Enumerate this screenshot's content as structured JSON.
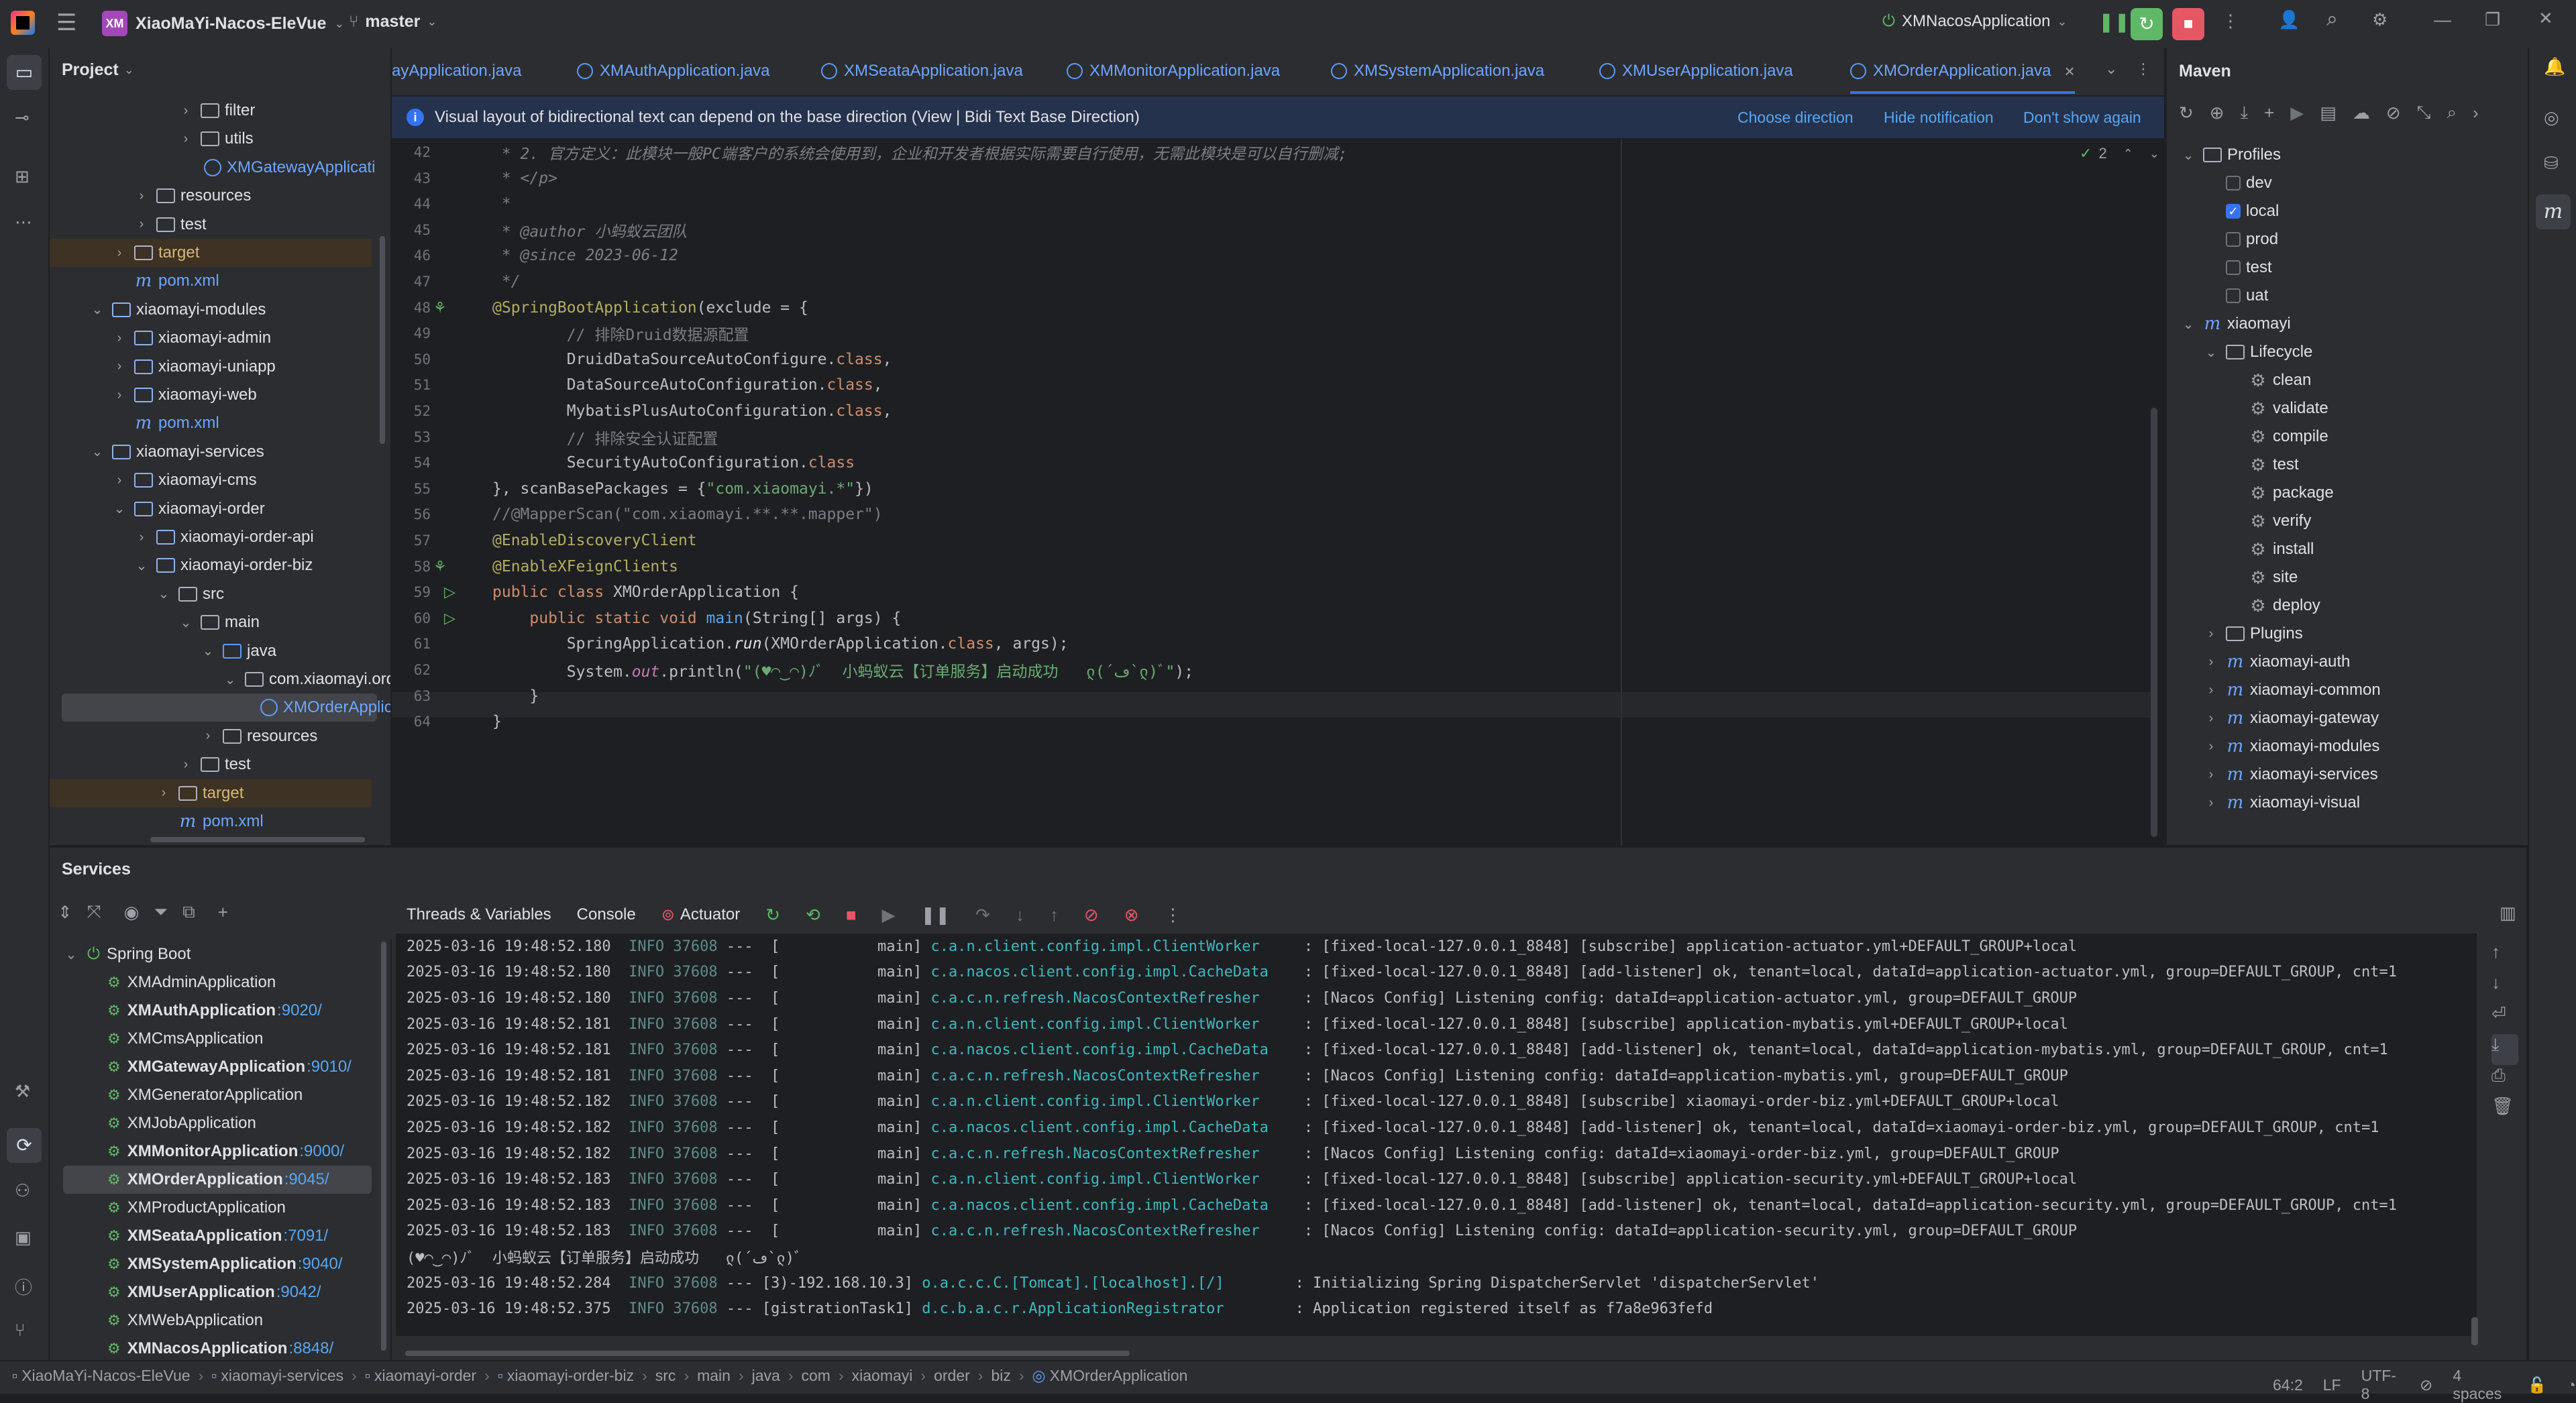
{
  "app": {
    "project_name": "XiaoMaYi-Nacos-EleVue",
    "project_badge": "XM",
    "branch": "master",
    "run_config": "XMNacosApplication"
  },
  "colors": {
    "accent": "#3574f0",
    "run_green": "#5fb865",
    "stop_red": "#e55765",
    "tab_blue": "#6ea6ff"
  },
  "project_panel": {
    "title": "Project",
    "tree": [
      {
        "label": "filter",
        "indent": 5,
        "icon": "folder",
        "arrow": "right"
      },
      {
        "label": "utils",
        "indent": 5,
        "icon": "folder",
        "arrow": "right"
      },
      {
        "label": "XMGatewayApplicati",
        "indent": 6,
        "icon": "class",
        "color": "blue"
      },
      {
        "label": "resources",
        "indent": 3,
        "icon": "folder-res",
        "arrow": "right"
      },
      {
        "label": "test",
        "indent": 3,
        "icon": "folder",
        "arrow": "right"
      },
      {
        "label": "target",
        "indent": 2,
        "icon": "folder",
        "arrow": "right",
        "color": "yellow",
        "hl": "orange"
      },
      {
        "label": "pom.xml",
        "indent": 2,
        "icon": "maven",
        "color": "blue"
      },
      {
        "label": "xiaomayi-modules",
        "indent": 1,
        "icon": "folder-mod",
        "arrow": "down"
      },
      {
        "label": "xiaomayi-admin",
        "indent": 2,
        "icon": "folder-mod",
        "arrow": "right"
      },
      {
        "label": "xiaomayi-uniapp",
        "indent": 2,
        "icon": "folder-mod",
        "arrow": "right"
      },
      {
        "label": "xiaomayi-web",
        "indent": 2,
        "icon": "folder-mod",
        "arrow": "right"
      },
      {
        "label": "pom.xml",
        "indent": 2,
        "icon": "maven",
        "color": "blue"
      },
      {
        "label": "xiaomayi-services",
        "indent": 1,
        "icon": "folder-mod",
        "arrow": "down"
      },
      {
        "label": "xiaomayi-cms",
        "indent": 2,
        "icon": "folder-mod",
        "arrow": "right"
      },
      {
        "label": "xiaomayi-order",
        "indent": 2,
        "icon": "folder-mod",
        "arrow": "down"
      },
      {
        "label": "xiaomayi-order-api",
        "indent": 3,
        "icon": "folder-mod",
        "arrow": "right"
      },
      {
        "label": "xiaomayi-order-biz",
        "indent": 3,
        "icon": "folder-mod",
        "arrow": "down"
      },
      {
        "label": "src",
        "indent": 4,
        "icon": "folder",
        "arrow": "down"
      },
      {
        "label": "main",
        "indent": 5,
        "icon": "folder",
        "arrow": "down"
      },
      {
        "label": "java",
        "indent": 6,
        "icon": "folder-src",
        "arrow": "down"
      },
      {
        "label": "com.xiaomayi.ord",
        "indent": 7,
        "icon": "folder",
        "arrow": "down"
      },
      {
        "label": "XMOrderApplic",
        "indent": 8,
        "icon": "class",
        "color": "blue",
        "hl": "sel"
      },
      {
        "label": "resources",
        "indent": 6,
        "icon": "folder-res",
        "arrow": "right"
      },
      {
        "label": "test",
        "indent": 5,
        "icon": "folder",
        "arrow": "right"
      },
      {
        "label": "target",
        "indent": 4,
        "icon": "folder",
        "arrow": "right",
        "color": "yellow",
        "hl": "orange"
      },
      {
        "label": "pom.xml",
        "indent": 4,
        "icon": "maven",
        "color": "blue"
      },
      {
        "label": "pom.xml",
        "indent": 3,
        "icon": "maven",
        "color": "blue"
      }
    ]
  },
  "editor": {
    "tabs": [
      {
        "label": "ayApplication.java"
      },
      {
        "label": "XMAuthApplication.java"
      },
      {
        "label": "XMSeataApplication.java"
      },
      {
        "label": "XMMonitorApplication.java"
      },
      {
        "label": "XMSystemApplication.java"
      },
      {
        "label": "XMUserApplication.java"
      },
      {
        "label": "XMOrderApplication.java",
        "active": true
      }
    ],
    "notification": {
      "text": "Visual layout of bidirectional text can depend on the base direction (View | Bidi Text Base Direction)",
      "choose": "Choose direction",
      "hide": "Hide notification",
      "dont_show": "Don't show again"
    },
    "inspection_count": "2",
    "lines": [
      {
        "n": "42",
        "code": [
          [
            " * 2. 官方定义：此模块一般PC端客户的系统会使用到，企业和开发者根据实际需要自行使用，无需此模块是可以自行删减;",
            "cm it"
          ]
        ]
      },
      {
        "n": "43",
        "code": [
          [
            " * </p>",
            "cm it"
          ]
        ]
      },
      {
        "n": "44",
        "code": [
          [
            " *",
            "cm it"
          ]
        ]
      },
      {
        "n": "45",
        "code": [
          [
            " * ",
            "cm it"
          ],
          [
            "@author",
            "cm it"
          ],
          [
            " 小蚂蚁云团队",
            "cm it"
          ]
        ]
      },
      {
        "n": "46",
        "code": [
          [
            " * ",
            "cm it"
          ],
          [
            "@since",
            "cm it"
          ],
          [
            " 2023-06-12",
            "cm it"
          ]
        ]
      },
      {
        "n": "47",
        "code": [
          [
            " */",
            "cm it"
          ]
        ]
      },
      {
        "n": "48",
        "code": [
          [
            "@SpringBootApplication",
            "an"
          ],
          [
            "(exclude = {",
            "pu"
          ]
        ]
      },
      {
        "n": "49",
        "code": [
          [
            "        // 排除Druid数据源配置",
            "cm"
          ]
        ]
      },
      {
        "n": "50",
        "code": [
          [
            "        DruidDataSourceAutoConfigure.",
            "pu"
          ],
          [
            "class",
            "k"
          ],
          [
            ",",
            "pu"
          ]
        ]
      },
      {
        "n": "51",
        "code": [
          [
            "        DataSourceAutoConfiguration.",
            "pu"
          ],
          [
            "class",
            "k"
          ],
          [
            ",",
            "pu"
          ]
        ]
      },
      {
        "n": "52",
        "code": [
          [
            "        MybatisPlusAutoConfiguration.",
            "pu"
          ],
          [
            "class",
            "k"
          ],
          [
            ",",
            "pu"
          ]
        ]
      },
      {
        "n": "53",
        "code": [
          [
            "        // 排除安全认证配置",
            "cm"
          ]
        ]
      },
      {
        "n": "54",
        "code": [
          [
            "        SecurityAutoConfiguration.",
            "pu"
          ],
          [
            "class",
            "k"
          ]
        ]
      },
      {
        "n": "55",
        "code": [
          [
            "}, scanBasePackages = {",
            "pu"
          ],
          [
            "\"com.xiaomayi.*\"",
            "st"
          ],
          [
            "})",
            "pu"
          ]
        ]
      },
      {
        "n": "56",
        "code": [
          [
            "//@MapperScan(\"com.xiaomayi.**.**.mapper\")",
            "cm"
          ]
        ]
      },
      {
        "n": "57",
        "code": [
          [
            "@EnableDiscoveryClient",
            "an"
          ]
        ]
      },
      {
        "n": "58",
        "code": [
          [
            "@EnableXFeignClients",
            "an"
          ]
        ]
      },
      {
        "n": "59",
        "code": [
          [
            "public class ",
            "k"
          ],
          [
            "XMOrderApplication ",
            "pu"
          ],
          [
            "{",
            "pu"
          ]
        ]
      },
      {
        "n": "60",
        "code": [
          [
            "    public static void ",
            "k"
          ],
          [
            "main",
            "fn"
          ],
          [
            "(String[] args) {",
            "pu"
          ]
        ]
      },
      {
        "n": "61",
        "code": [
          [
            "        SpringApplication.",
            "pu"
          ],
          [
            "run",
            "it"
          ],
          [
            "(XMOrderApplication.",
            "pu"
          ],
          [
            "class",
            "k"
          ],
          [
            ", args);",
            "pu"
          ]
        ]
      },
      {
        "n": "62",
        "code": [
          [
            "        System.",
            "pu"
          ],
          [
            "out",
            "sf"
          ],
          [
            ".println(",
            "pu"
          ],
          [
            "\"(♥◠‿◠)ﾉﾞ  小蚂蚁云【订单服务】启动成功   ლ(´ڡ`ლ)ﾞ\"",
            "st"
          ],
          [
            ");",
            "pu"
          ]
        ]
      },
      {
        "n": "63",
        "code": [
          [
            "    }",
            "pu"
          ]
        ]
      },
      {
        "n": "64",
        "code": [
          [
            "}",
            "pu"
          ]
        ]
      }
    ],
    "gutter_marks": {
      "48": "spring",
      "58": "spring",
      "59": "run",
      "60": "run"
    }
  },
  "maven": {
    "title": "Maven",
    "tree": [
      {
        "label": "Profiles",
        "indent": 0,
        "arrow": "down",
        "icon": "folder"
      },
      {
        "label": "dev",
        "indent": 1,
        "icon": "check",
        "checked": false
      },
      {
        "label": "local",
        "indent": 1,
        "icon": "check",
        "checked": true
      },
      {
        "label": "prod",
        "indent": 1,
        "icon": "check",
        "checked": false
      },
      {
        "label": "test",
        "indent": 1,
        "icon": "check",
        "checked": false
      },
      {
        "label": "uat",
        "indent": 1,
        "icon": "check",
        "checked": false
      },
      {
        "label": "xiaomayi",
        "indent": 0,
        "arrow": "down",
        "icon": "maven"
      },
      {
        "label": "Lifecycle",
        "indent": 1,
        "arrow": "down",
        "icon": "folder"
      },
      {
        "label": "clean",
        "indent": 2,
        "icon": "gear"
      },
      {
        "label": "validate",
        "indent": 2,
        "icon": "gear"
      },
      {
        "label": "compile",
        "indent": 2,
        "icon": "gear"
      },
      {
        "label": "test",
        "indent": 2,
        "icon": "gear"
      },
      {
        "label": "package",
        "indent": 2,
        "icon": "gear"
      },
      {
        "label": "verify",
        "indent": 2,
        "icon": "gear"
      },
      {
        "label": "install",
        "indent": 2,
        "icon": "gear"
      },
      {
        "label": "site",
        "indent": 2,
        "icon": "gear"
      },
      {
        "label": "deploy",
        "indent": 2,
        "icon": "gear"
      },
      {
        "label": "Plugins",
        "indent": 1,
        "arrow": "right",
        "icon": "folder"
      },
      {
        "label": "xiaomayi-auth",
        "indent": 1,
        "arrow": "right",
        "icon": "maven"
      },
      {
        "label": "xiaomayi-common",
        "indent": 1,
        "arrow": "right",
        "icon": "maven"
      },
      {
        "label": "xiaomayi-gateway",
        "indent": 1,
        "arrow": "right",
        "icon": "maven"
      },
      {
        "label": "xiaomayi-modules",
        "indent": 1,
        "arrow": "right",
        "icon": "maven"
      },
      {
        "label": "xiaomayi-services",
        "indent": 1,
        "arrow": "right",
        "icon": "maven"
      },
      {
        "label": "xiaomayi-visual",
        "indent": 1,
        "arrow": "right",
        "icon": "maven"
      }
    ]
  },
  "services": {
    "title": "Services",
    "root": "Spring Boot",
    "apps": [
      {
        "name": "XMAdminApplication",
        "port": "",
        "running": false
      },
      {
        "name": "XMAuthApplication",
        "port": ":9020/",
        "running": true
      },
      {
        "name": "XMCmsApplication",
        "port": "",
        "running": false
      },
      {
        "name": "XMGatewayApplication",
        "port": ":9010/",
        "running": true
      },
      {
        "name": "XMGeneratorApplication",
        "port": "",
        "running": false
      },
      {
        "name": "XMJobApplication",
        "port": "",
        "running": false
      },
      {
        "name": "XMMonitorApplication",
        "port": ":9000/",
        "running": true
      },
      {
        "name": "XMOrderApplication",
        "port": ":9045/",
        "running": true,
        "selected": true
      },
      {
        "name": "XMProductApplication",
        "port": "",
        "running": false
      },
      {
        "name": "XMSeataApplication",
        "port": ":7091/",
        "running": true
      },
      {
        "name": "XMSystemApplication",
        "port": ":9040/",
        "running": true
      },
      {
        "name": "XMUserApplication",
        "port": ":9042/",
        "running": true
      },
      {
        "name": "XMWebApplication",
        "port": "",
        "running": false
      },
      {
        "name": "XMNacosApplication",
        "port": ":8848/",
        "running": true
      }
    ],
    "console_tabs": [
      "Threads & Variables",
      "Console",
      "Actuator"
    ],
    "log": [
      {
        "ts": "2025-03-16 19:48:52.180",
        "lvl": "INFO",
        "pid": "37608",
        "thr": "---  [           main]",
        "cls": "c.a.n.client.config.impl.ClientWorker    ",
        "msg": ": [fixed-local-127.0.0.1_8848] [subscribe] application-actuator.yml+DEFAULT_GROUP+local"
      },
      {
        "ts": "2025-03-16 19:48:52.180",
        "lvl": "INFO",
        "pid": "37608",
        "thr": "---  [           main]",
        "cls": "c.a.nacos.client.config.impl.CacheData   ",
        "msg": ": [fixed-local-127.0.0.1_8848] [add-listener] ok, tenant=local, dataId=application-actuator.yml, group=DEFAULT_GROUP, cnt=1"
      },
      {
        "ts": "2025-03-16 19:48:52.180",
        "lvl": "INFO",
        "pid": "37608",
        "thr": "---  [           main]",
        "cls": "c.a.c.n.refresh.NacosContextRefresher    ",
        "msg": ": [Nacos Config] Listening config: dataId=application-actuator.yml, group=DEFAULT_GROUP"
      },
      {
        "ts": "2025-03-16 19:48:52.181",
        "lvl": "INFO",
        "pid": "37608",
        "thr": "---  [           main]",
        "cls": "c.a.n.client.config.impl.ClientWorker    ",
        "msg": ": [fixed-local-127.0.0.1_8848] [subscribe] application-mybatis.yml+DEFAULT_GROUP+local"
      },
      {
        "ts": "2025-03-16 19:48:52.181",
        "lvl": "INFO",
        "pid": "37608",
        "thr": "---  [           main]",
        "cls": "c.a.nacos.client.config.impl.CacheData   ",
        "msg": ": [fixed-local-127.0.0.1_8848] [add-listener] ok, tenant=local, dataId=application-mybatis.yml, group=DEFAULT_GROUP, cnt=1"
      },
      {
        "ts": "2025-03-16 19:48:52.181",
        "lvl": "INFO",
        "pid": "37608",
        "thr": "---  [           main]",
        "cls": "c.a.c.n.refresh.NacosContextRefresher    ",
        "msg": ": [Nacos Config] Listening config: dataId=application-mybatis.yml, group=DEFAULT_GROUP"
      },
      {
        "ts": "2025-03-16 19:48:52.182",
        "lvl": "INFO",
        "pid": "37608",
        "thr": "---  [           main]",
        "cls": "c.a.n.client.config.impl.ClientWorker    ",
        "msg": ": [fixed-local-127.0.0.1_8848] [subscribe] xiaomayi-order-biz.yml+DEFAULT_GROUP+local"
      },
      {
        "ts": "2025-03-16 19:48:52.182",
        "lvl": "INFO",
        "pid": "37608",
        "thr": "---  [           main]",
        "cls": "c.a.nacos.client.config.impl.CacheData   ",
        "msg": ": [fixed-local-127.0.0.1_8848] [add-listener] ok, tenant=local, dataId=xiaomayi-order-biz.yml, group=DEFAULT_GROUP, cnt=1"
      },
      {
        "ts": "2025-03-16 19:48:52.182",
        "lvl": "INFO",
        "pid": "37608",
        "thr": "---  [           main]",
        "cls": "c.a.c.n.refresh.NacosContextRefresher    ",
        "msg": ": [Nacos Config] Listening config: dataId=xiaomayi-order-biz.yml, group=DEFAULT_GROUP"
      },
      {
        "ts": "2025-03-16 19:48:52.183",
        "lvl": "INFO",
        "pid": "37608",
        "thr": "---  [           main]",
        "cls": "c.a.n.client.config.impl.ClientWorker    ",
        "msg": ": [fixed-local-127.0.0.1_8848] [subscribe] application-security.yml+DEFAULT_GROUP+local"
      },
      {
        "ts": "2025-03-16 19:48:52.183",
        "lvl": "INFO",
        "pid": "37608",
        "thr": "---  [           main]",
        "cls": "c.a.nacos.client.config.impl.CacheData   ",
        "msg": ": [fixed-local-127.0.0.1_8848] [add-listener] ok, tenant=local, dataId=application-security.yml, group=DEFAULT_GROUP, cnt=1"
      },
      {
        "ts": "2025-03-16 19:48:52.183",
        "lvl": "INFO",
        "pid": "37608",
        "thr": "---  [           main]",
        "cls": "c.a.c.n.refresh.NacosContextRefresher    ",
        "msg": ": [Nacos Config] Listening config: dataId=application-security.yml, group=DEFAULT_GROUP"
      },
      {
        "plain": "(♥◠‿◠)ﾉﾞ  小蚂蚁云【订单服务】启动成功   ლ(´ڡ`ლ)ﾞ"
      },
      {
        "ts": "2025-03-16 19:48:52.284",
        "lvl": "INFO",
        "pid": "37608",
        "thr": "--- [3)-192.168.10.3]",
        "cls": "o.a.c.c.C.[Tomcat].[localhost].[/]       ",
        "msg": ": Initializing Spring DispatcherServlet 'dispatcherServlet'"
      },
      {
        "ts": "2025-03-16 19:48:52.375",
        "lvl": "INFO",
        "pid": "37608",
        "thr": "--- [gistrationTask1]",
        "cls": "d.c.b.a.c.r.ApplicationRegistrator       ",
        "msg": ": Application registered itself as f7a8e963fefd"
      }
    ]
  },
  "statusbar": {
    "breadcrumb": [
      "XiaoMaYi-Nacos-EleVue",
      "xiaomayi-services",
      "xiaomayi-order",
      "xiaomayi-order-biz",
      "src",
      "main",
      "java",
      "com",
      "xiaomayi",
      "order",
      "biz",
      "XMOrderApplication"
    ],
    "position": "64:2",
    "line_sep": "LF",
    "encoding": "UTF-8",
    "indent": "4 spaces"
  }
}
